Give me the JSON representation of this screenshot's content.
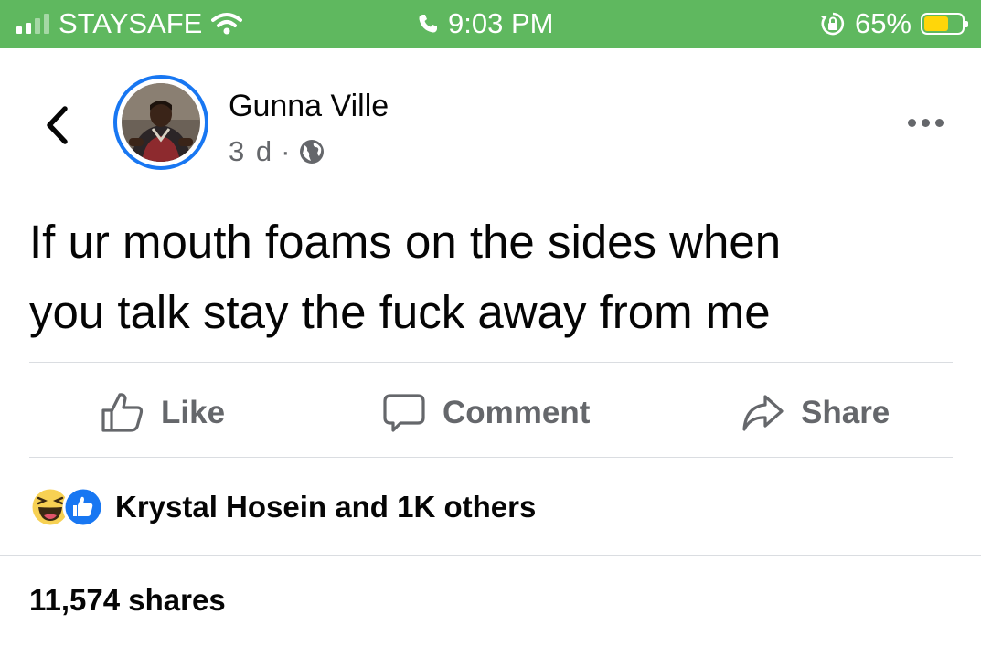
{
  "status_bar": {
    "carrier": "STAYSAFE",
    "time": "9:03 PM",
    "battery_percent": "65%",
    "battery_level": 0.65,
    "icons": [
      "signal-icon",
      "wifi-icon",
      "phone-call-icon",
      "orientation-lock-icon",
      "battery-icon"
    ],
    "background_color": "#5fb85f"
  },
  "post": {
    "author": "Gunna Ville",
    "time_ago": "3 d",
    "separator": "·",
    "privacy_icon": "globe-icon",
    "text": "If ur mouth foams on the sides when\nyou talk stay the fuck away from me"
  },
  "actions": {
    "like": "Like",
    "comment": "Comment",
    "share": "Share"
  },
  "reactions": {
    "icons": [
      "haha-reaction-icon",
      "like-reaction-icon"
    ],
    "summary": "Krystal Hosein and 1K others"
  },
  "shares": "11,574 shares",
  "colors": {
    "accent": "#1877f2",
    "secondary_text": "#65676b",
    "primary_text": "#050505"
  }
}
